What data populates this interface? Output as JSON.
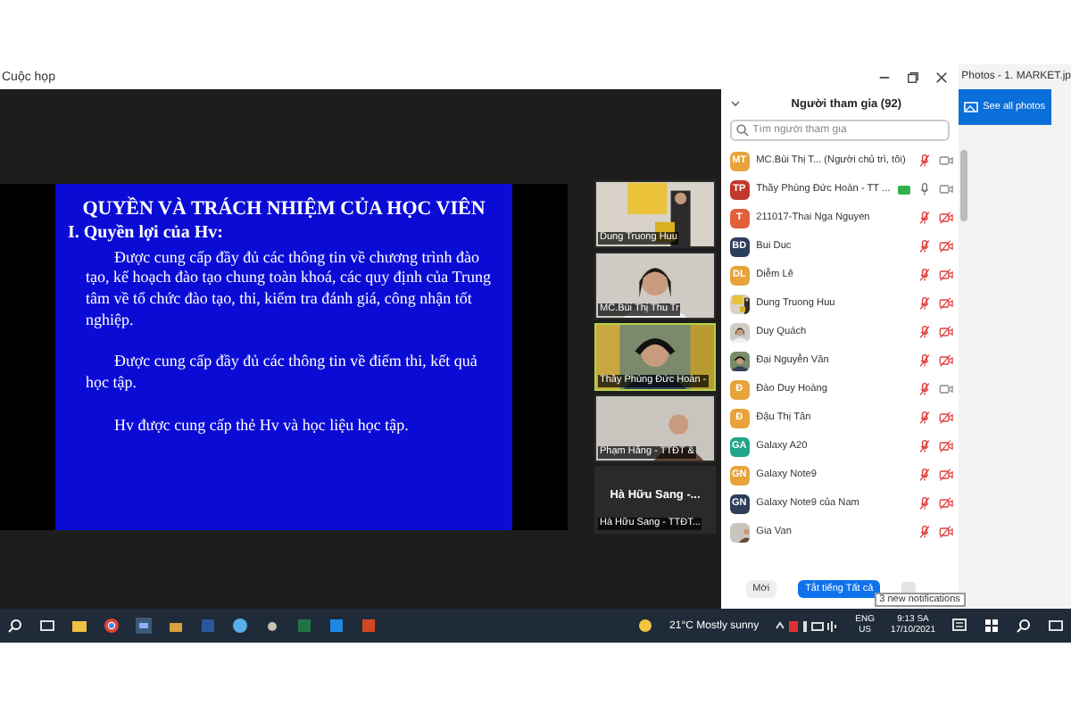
{
  "meeting": {
    "title": "Cuộc họp",
    "slide": {
      "title": "QUYỀN VÀ TRÁCH NHIỆM CỦA HỌC VIÊN",
      "heading": "I. Quyền lợi của Hv:",
      "paragraphs": [
        "Được cung cấp đầy đủ các thông tin về chương trình đào tạo, kế hoạch đào tạo chung toàn khoá, các quy định của Trung tâm về tổ chức đào tạo, thi, kiểm tra đánh giá, công nhận tốt nghiệp.",
        "Được cung cấp đầy đủ các thông tin về điểm thi, kết quả học tập.",
        "Hv được cung cấp thẻ Hv và học liệu học tập."
      ]
    },
    "gallery": [
      {
        "kind": "video",
        "name": "Dung Truong Huu",
        "selected": false
      },
      {
        "kind": "video",
        "name": "MC.Bùi Thị Thu Tr",
        "selected": false
      },
      {
        "kind": "video",
        "name": "Thầy Phùng Đức Hoàn -",
        "selected": true
      },
      {
        "kind": "video",
        "name": "Phạm Hằng - TTĐT &",
        "selected": false
      },
      {
        "kind": "name",
        "display": "Hà Hữu Sang -...",
        "name": "Hà Hữu Sang - TTĐT...",
        "selected": false
      }
    ]
  },
  "participants": {
    "title": "Người tham gia (92)",
    "search": {
      "placeholder": "Tìm người tham gia"
    },
    "rows": [
      {
        "kind": "initials",
        "initials": "MT",
        "color": "#e8a33a",
        "name": "MC.Bùi Thị T... (Người chủ trì, tôi)",
        "sharing": false,
        "mic_muted": true,
        "video_muted": false
      },
      {
        "kind": "initials",
        "initials": "TP",
        "color": "#c0392b",
        "name": "Thầy Phùng Đức Hoàn - TT ...",
        "sharing": true,
        "mic_muted": false,
        "video_muted": false
      },
      {
        "kind": "initials",
        "initials": "T",
        "color": "#e0603a",
        "name": "211017-Thai Nga Nguyen",
        "sharing": false,
        "mic_muted": true,
        "video_muted": true
      },
      {
        "kind": "initials",
        "initials": "BD",
        "color": "#2c3e5a",
        "name": "Bui Duc",
        "sharing": false,
        "mic_muted": true,
        "video_muted": true
      },
      {
        "kind": "initials",
        "initials": "DL",
        "color": "#e8a33a",
        "name": "Diễm Lê",
        "sharing": false,
        "mic_muted": true,
        "video_muted": true
      },
      {
        "name": "Dung Truong Huu",
        "sharing": false,
        "mic_muted": true,
        "video_muted": true
      },
      {
        "name": "Duy Quách",
        "sharing": false,
        "mic_muted": true,
        "video_muted": true
      },
      {
        "name": "Đại Nguyễn Văn",
        "sharing": false,
        "mic_muted": true,
        "video_muted": true
      },
      {
        "kind": "initials",
        "initials": "Đ",
        "color": "#e8a33a",
        "name": "Đào Duy Hoàng",
        "sharing": false,
        "mic_muted": true,
        "video_muted": false
      },
      {
        "kind": "initials",
        "initials": "Đ",
        "color": "#e8a33a",
        "name": "Đậu Thị Tân",
        "sharing": false,
        "mic_muted": true,
        "video_muted": true
      },
      {
        "kind": "initials",
        "initials": "GA",
        "color": "#1fa58a",
        "name": "Galaxy A20",
        "sharing": false,
        "mic_muted": true,
        "video_muted": true
      },
      {
        "kind": "initials",
        "initials": "GN",
        "color": "#e8a33a",
        "name": "Galaxy Note9",
        "sharing": false,
        "mic_muted": true,
        "video_muted": true
      },
      {
        "kind": "initials",
        "initials": "GN",
        "color": "#2c3e5a",
        "name": "Galaxy Note9 của Nam",
        "sharing": false,
        "mic_muted": true,
        "video_muted": true
      },
      {
        "name": "Gia Van",
        "sharing": false,
        "mic_muted": true,
        "video_muted": true
      }
    ],
    "buttons": [
      "Mời",
      "Tắt tiếng Tất cả"
    ],
    "tooltip": "3 new notifications"
  },
  "photos": {
    "title": "Photos - 1. MARKET.jp",
    "button": "See all photos"
  },
  "taskbar": {
    "weather": "21°C  Mostly sunny",
    "language": [
      "ENG",
      "US"
    ],
    "time": "9:13 SA",
    "date": "17/10/2021"
  }
}
